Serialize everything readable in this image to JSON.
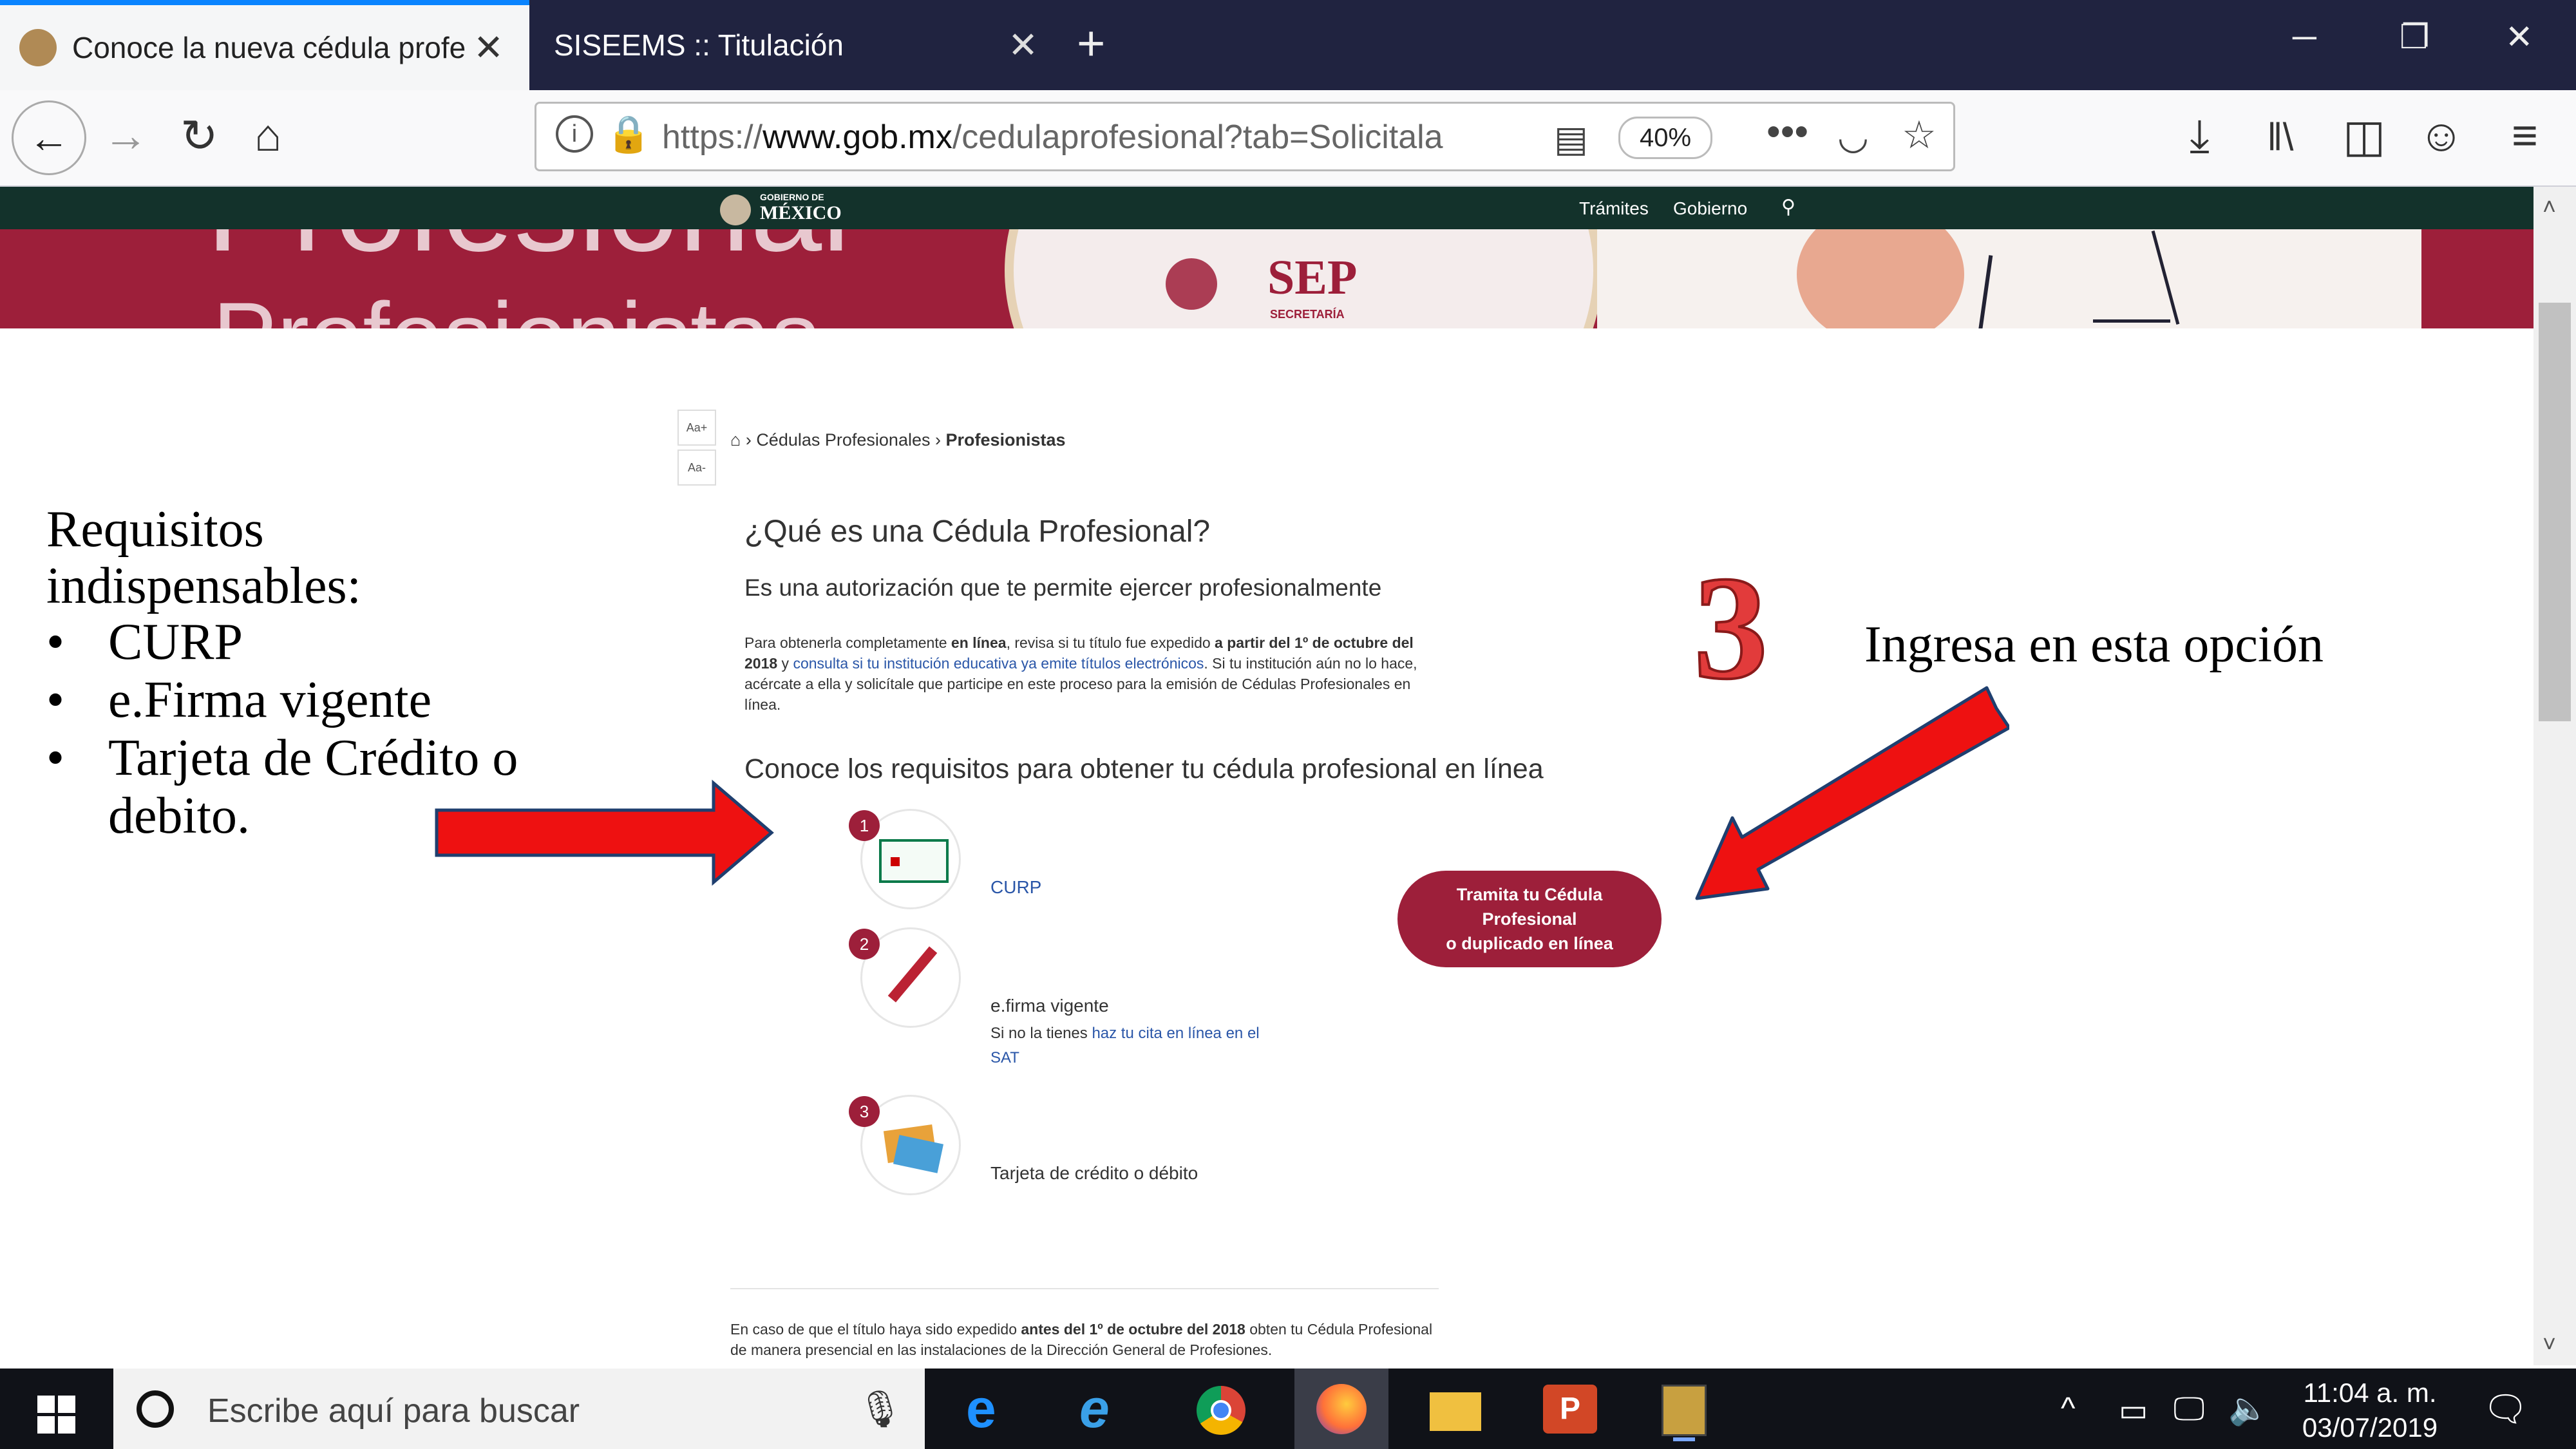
{
  "browser": {
    "tabs": [
      {
        "label": "Conoce la nueva cédula profesi",
        "active": true
      },
      {
        "label": "SISEEMS :: Titulación",
        "active": false
      }
    ],
    "url_prefix": "https://",
    "url_host": "www.gob.mx",
    "url_path": "/cedulaprofesional?tab=Solicitala",
    "zoom": "40%",
    "accent_color": "#0a84ff"
  },
  "site": {
    "gov_logo_top": "GOBIERNO DE",
    "gov_logo": "MÉXICO",
    "nav_tramites": "Trámites",
    "nav_gobierno": "Gobierno",
    "banner_text_1": "Profesional",
    "banner_text_2": "Profesionistas",
    "sep_logo": "SEP",
    "sep_sub": "SECRETARÍA",
    "font_large": "Aa+",
    "font_small": "Aa-",
    "breadcrumb_1": "Cédulas Profesionales",
    "breadcrumb_2": "Profesionistas",
    "heading": "¿Qué es una Cédula Profesional?",
    "subheading": "Es una autorización que te permite ejercer profesionalmente",
    "para_1": "Para obtenerla completamente",
    "para_bold_1": "en línea",
    "para_2": ", revisa si tu título fue expedido",
    "para_bold_2": "a partir del 1º de octubre del 2018",
    "para_3": " y ",
    "para_link": "consulta si tu institución educativa ya emite títulos electrónicos",
    "para_4": ". Si tu institución aún no lo hace, acércate a ella y solicítale que participe en este proceso para la emisión de Cédulas Profesionales en línea.",
    "req_heading": "Conoce los requisitos para obtener tu cédula profesional en línea",
    "req_items": [
      {
        "num": "1",
        "label": "CURP",
        "note": "",
        "note_link": ""
      },
      {
        "num": "2",
        "label": "e.firma vigente",
        "note": "Si no la tienes",
        "note_link": "haz tu cita en línea en el SAT"
      },
      {
        "num": "3",
        "label": "Tarjeta de crédito o débito",
        "note": "",
        "note_link": ""
      }
    ],
    "cta_line1": "Tramita tu Cédula",
    "cta_line2": "Profesional",
    "cta_line3": "o duplicado en línea",
    "footer_1": "En caso de que el título haya sido expedido",
    "footer_bold": "antes del 1º de octubre del 2018",
    "footer_2": " obten tu Cédula Profesional de manera presencial en las instalaciones de la Dirección General de Profesiones.",
    "brand_color": "#9d1f3a",
    "dark_green": "#13322b"
  },
  "annotations": {
    "req_title_1": "Requisitos",
    "req_title_2": "indispensables:",
    "bullets": [
      "CURP",
      "e.Firma vigente",
      "Tarjeta de Crédito o",
      "debito."
    ],
    "step_number": "3",
    "instruction": "Ingresa en esta opción",
    "arrow_color": "#ee1111"
  },
  "taskbar": {
    "search_placeholder": "Escribe aquí para buscar",
    "time": "11:04 a. m.",
    "date": "03/07/2019",
    "apps": [
      "edge-icon",
      "ie-icon",
      "chrome-icon",
      "firefox-icon",
      "file-explorer-icon",
      "powerpoint-icon",
      "winrar-icon"
    ]
  }
}
